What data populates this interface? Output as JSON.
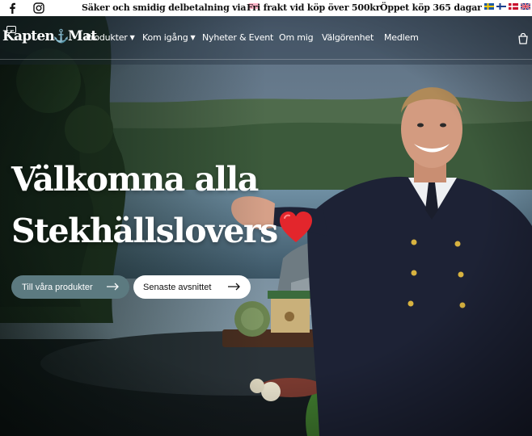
{
  "announcement": {
    "messages": [
      "Säker och smidig delbetalning via",
      "Fri frakt vid köp över 500kr",
      "Öppet köp 365 dagar"
    ],
    "social_icons": [
      "facebook-icon",
      "instagram-icon"
    ],
    "payment_badge": "Klarna",
    "language_flags": [
      "sweden-flag",
      "finland-flag",
      "denmark-flag",
      "uk-flag"
    ]
  },
  "nav": {
    "logo_left": "Kapten",
    "logo_anchor": "⚓",
    "logo_right": "Mat",
    "items": [
      {
        "label": "Produkter",
        "has_dropdown": true
      },
      {
        "label": "Kom igång",
        "has_dropdown": true
      },
      {
        "label": "Nyheter & Event",
        "has_dropdown": false
      },
      {
        "label": "Om mig",
        "has_dropdown": false
      },
      {
        "label": "Välgörenhet",
        "has_dropdown": false
      },
      {
        "label": "Medlem",
        "has_dropdown": false
      }
    ],
    "chevron": "⌄"
  },
  "hero": {
    "headline_line1": "Välkomna alla",
    "headline_line2": "Stekhällslovers",
    "primary_button": "Till våra produkter",
    "secondary_button": "Senaste avsnittet"
  },
  "colors": {
    "primary_button_bg": "#5c7a80",
    "secondary_button_bg": "#ffffff",
    "text_on_hero": "#ffffff",
    "heart": "#e3262c"
  }
}
